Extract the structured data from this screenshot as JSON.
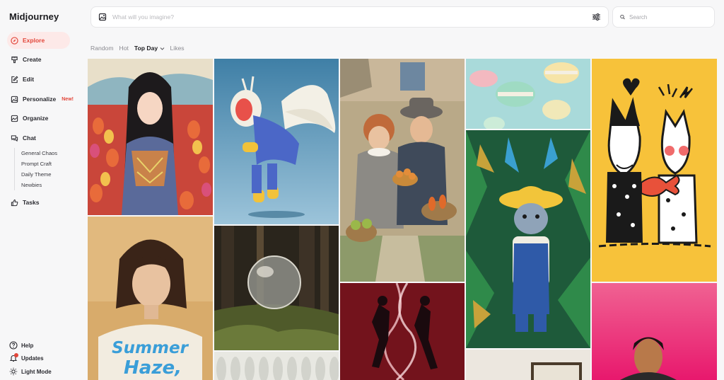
{
  "app": {
    "name": "Midjourney"
  },
  "nav": {
    "explore": "Explore",
    "create": "Create",
    "edit": "Edit",
    "personalize": "Personalize",
    "personalize_badge": "New!",
    "organize": "Organize",
    "chat": "Chat",
    "chat_rooms": [
      "General Chaos",
      "Prompt Craft",
      "Daily Theme",
      "Newbies"
    ],
    "tasks": "Tasks"
  },
  "footer": {
    "help": "Help",
    "updates": "Updates",
    "light_mode": "Light Mode"
  },
  "imagine": {
    "placeholder": "What will you imagine?"
  },
  "search": {
    "placeholder": "Search"
  },
  "tabs": {
    "random": "Random",
    "hot": "Hot",
    "top_day": "Top Day",
    "likes": "Likes",
    "selected": "Top Day"
  },
  "gallery": {
    "poster_text_1": "Summer",
    "poster_text_2": "Haze,"
  },
  "colors": {
    "accent": "#e2463a",
    "active_bg": "#fde9e8"
  }
}
